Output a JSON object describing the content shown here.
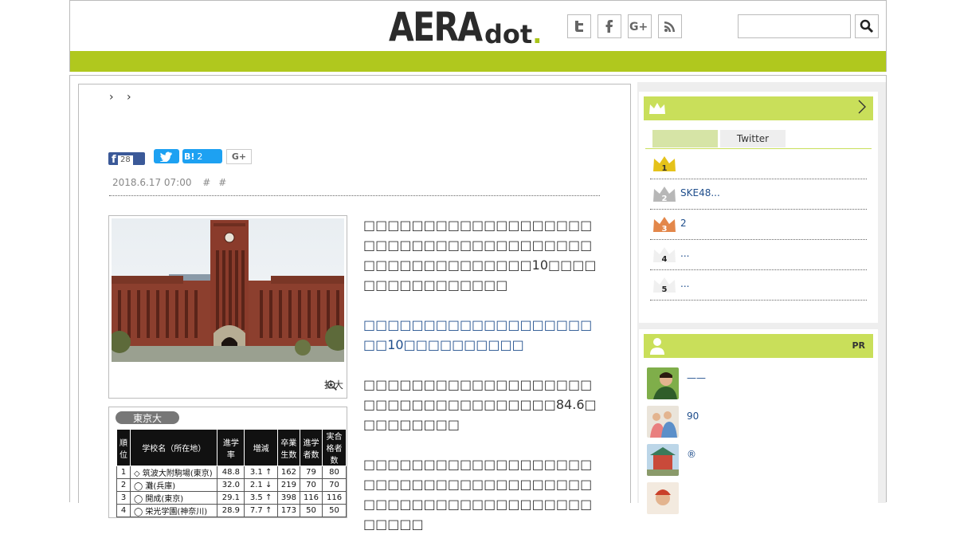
{
  "header": {
    "logo_main": "AERA",
    "logo_sub": "dot",
    "logo_dot": ".",
    "social_icons": [
      "twitter-icon",
      "facebook-icon",
      "google-plus-icon",
      "rss-icon"
    ],
    "search_placeholder": "",
    "brand_green": "#b0c81e"
  },
  "article": {
    "breadcrumb": "› ›",
    "share": {
      "facebook_count": "28",
      "hatena_label": "B!",
      "hatena_count": "2",
      "googleplus_label": "G+"
    },
    "date": "2018.6.17 07:00",
    "tags": [
      "#",
      "#"
    ],
    "zoom_label": "拡大",
    "paragraphs": [
      "□□□□□□□□□□□□□□□□□□□□□□□□□□□□□□□□□□□□□□□□□□□□□□□□□□□□10□□□□□□□□□□□□□□□□",
      "□□□□□□□□□□□□□□□□□□□□□10□□□□□□□□□□",
      "□□□□□□□□□□□□□□□□□□□□□□□□□□□□□□□□□□□84.6□□□□□□□□□",
      "□□□□□□□□□□□□□□□□□□□□□□□□□□□□□□□□□□□□□□□□□□□□□□□□□□□□□□□□□□□□□□"
    ],
    "table": {
      "title": "東京大",
      "headers": [
        "順位",
        "学校名（所在地）",
        "進学率",
        "増減",
        "卒業生数",
        "進学者数",
        "実合格者数"
      ],
      "rows": [
        [
          "1",
          "◇ 筑波大附駒場(東京)",
          "48.8",
          "3.1 ↑",
          "162",
          "79",
          "80"
        ],
        [
          "2",
          "◯ 灘(兵庫)",
          "32.0",
          "2.1 ↓",
          "219",
          "70",
          "70"
        ],
        [
          "3",
          "◯ 開成(東京)",
          "29.1",
          "3.5 ↑",
          "398",
          "116",
          "116"
        ],
        [
          "4",
          "◯ 栄光学園(神奈川)",
          "28.9",
          "7.7 ↑",
          "173",
          "50",
          "50"
        ]
      ]
    }
  },
  "sidebar": {
    "ranking": {
      "tabs": [
        "",
        "Twitter"
      ],
      "items": [
        {
          "rank": "1",
          "label": ""
        },
        {
          "rank": "2",
          "label": "SKE48..."
        },
        {
          "rank": "3",
          "label": "2"
        },
        {
          "rank": "4",
          "label": "..."
        },
        {
          "rank": "5",
          "label": "..."
        }
      ]
    },
    "pr": {
      "badge": "PR",
      "items": [
        {
          "label": "——"
        },
        {
          "label": "90"
        },
        {
          "label": "®"
        },
        {
          "label": ""
        }
      ]
    }
  }
}
